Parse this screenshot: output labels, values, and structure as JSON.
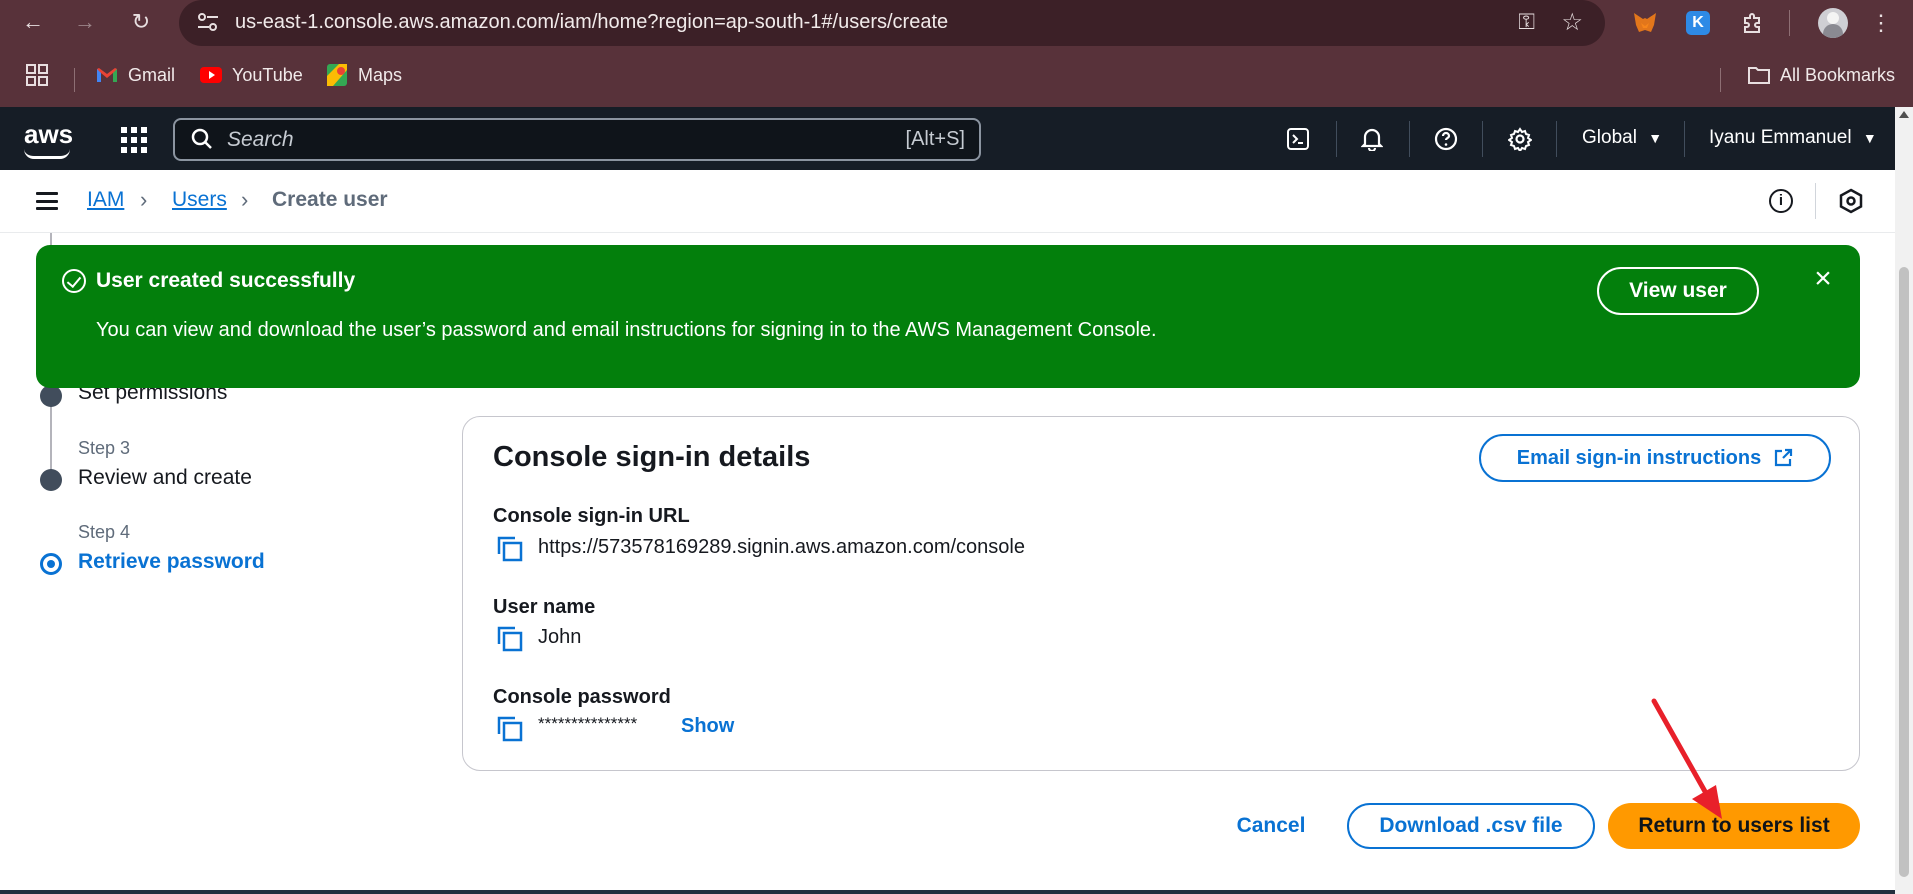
{
  "browser": {
    "url": "us-east-1.console.aws.amazon.com/iam/home?region=ap-south-1#/users/create",
    "bookmarks": [
      {
        "label": "Gmail",
        "icon": "gmail-icon"
      },
      {
        "label": "YouTube",
        "icon": "youtube-icon"
      },
      {
        "label": "Maps",
        "icon": "maps-icon"
      }
    ],
    "all_bookmarks_label": "All Bookmarks"
  },
  "aws_header": {
    "logo": "aws",
    "search_placeholder": "Search",
    "search_shortcut": "[Alt+S]",
    "region": "Global",
    "account": "Iyanu Emmanuel"
  },
  "breadcrumb": {
    "items": [
      {
        "label": "IAM",
        "link": true
      },
      {
        "label": "Users",
        "link": true
      },
      {
        "label": "Create user",
        "link": false
      }
    ]
  },
  "wizard": {
    "steps": [
      {
        "num": "",
        "title": "Set permissions",
        "state": "done"
      },
      {
        "num": "Step 3",
        "title": "Review and create",
        "state": "done"
      },
      {
        "num": "Step 4",
        "title": "Retrieve password",
        "state": "active"
      }
    ]
  },
  "flash": {
    "header": "User created successfully",
    "message": "You can view and download the user’s password and email instructions for signing in to the AWS Management Console.",
    "action_label": "View user",
    "color": "#037f0c"
  },
  "details": {
    "title": "Console sign-in details",
    "email_button": "Email sign-in instructions",
    "fields": [
      {
        "label": "Console sign-in URL",
        "value": "https://573578169289.signin.aws.amazon.com/console"
      },
      {
        "label": "User name",
        "value": "John"
      },
      {
        "label": "Console password",
        "value": "***************",
        "action": "Show"
      }
    ]
  },
  "footer": {
    "cancel": "Cancel",
    "download": "Download .csv file",
    "primary": "Return to users list",
    "primary_color": "#ff9900",
    "link_color": "#0972d3"
  },
  "annotation": {
    "type": "red-arrow",
    "color": "#e8202a"
  }
}
